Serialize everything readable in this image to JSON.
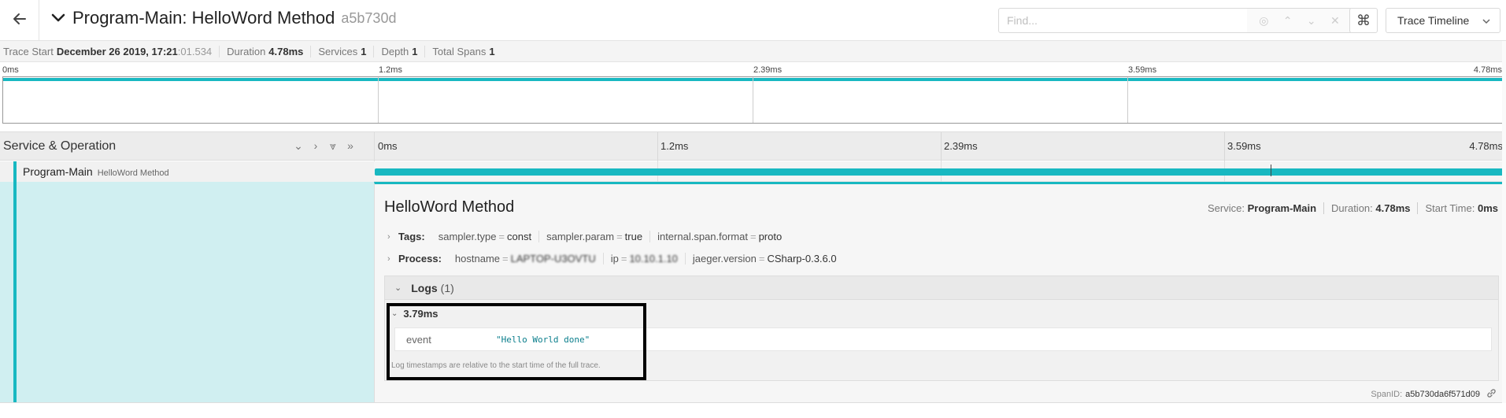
{
  "header": {
    "title": "Program-Main: HelloWord Method",
    "trace_id": "a5b730d",
    "find_placeholder": "Find...",
    "view_select": "Trace Timeline"
  },
  "summary": {
    "trace_start_label": "Trace Start",
    "trace_start_value": "December 26 2019, 17:21",
    "trace_start_ms": ":01.534",
    "duration_label": "Duration",
    "duration_value": "4.78ms",
    "services_label": "Services",
    "services_value": "1",
    "depth_label": "Depth",
    "depth_value": "1",
    "total_spans_label": "Total Spans",
    "total_spans_value": "1"
  },
  "minimap": {
    "ticks": [
      "0ms",
      "1.2ms",
      "2.39ms",
      "3.59ms",
      "4.78ms"
    ]
  },
  "timeline": {
    "header_label": "Service & Operation",
    "ticks": [
      "0ms",
      "1.2ms",
      "2.39ms",
      "3.59ms",
      "4.78ms"
    ]
  },
  "span": {
    "service": "Program-Main",
    "operation": "HelloWord Method",
    "log_offset_fraction": 0.792
  },
  "detail": {
    "operation": "HelloWord Method",
    "service_label": "Service:",
    "service_value": "Program-Main",
    "duration_label": "Duration:",
    "duration_value": "4.78ms",
    "start_label": "Start Time:",
    "start_value": "0ms",
    "tags_label": "Tags:",
    "tags": [
      {
        "k": "sampler.type",
        "v": "const"
      },
      {
        "k": "sampler.param",
        "v": "true"
      },
      {
        "k": "internal.span.format",
        "v": "proto"
      }
    ],
    "process_label": "Process:",
    "process": [
      {
        "k": "hostname",
        "v": "LAPTOP-U3OVTU"
      },
      {
        "k": "ip",
        "v": "10.10.1.10"
      },
      {
        "k": "jaeger.version",
        "v": "CSharp-0.3.6.0"
      }
    ],
    "logs_label": "Logs",
    "logs_count": "(1)",
    "log_time": "3.79ms",
    "log_key": "event",
    "log_value": "\"Hello World done\"",
    "log_note": "Log timestamps are relative to the start time of the full trace.",
    "span_id_label": "SpanID:",
    "span_id_value": "a5b730da6f571d09"
  },
  "colors": {
    "accent": "#18b8c1",
    "detail_bg": "#d0eff1"
  }
}
